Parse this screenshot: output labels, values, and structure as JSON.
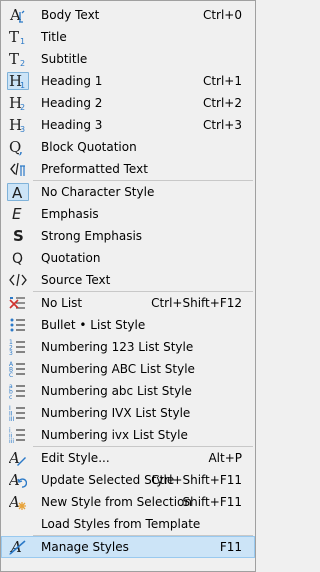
{
  "menu": {
    "items": [
      {
        "label": "Body Text",
        "shortcut": "Ctrl+0",
        "icon": "body-text-icon"
      },
      {
        "label": "Title",
        "shortcut": "",
        "icon": "title-icon"
      },
      {
        "label": "Subtitle",
        "shortcut": "",
        "icon": "subtitle-icon"
      },
      {
        "label": "Heading 1",
        "shortcut": "Ctrl+1",
        "icon": "heading-1-icon",
        "checked": true
      },
      {
        "label": "Heading 2",
        "shortcut": "Ctrl+2",
        "icon": "heading-2-icon"
      },
      {
        "label": "Heading 3",
        "shortcut": "Ctrl+3",
        "icon": "heading-3-icon"
      },
      {
        "label": "Block Quotation",
        "shortcut": "",
        "icon": "block-quotation-icon"
      },
      {
        "label": "Preformatted Text",
        "shortcut": "",
        "icon": "preformatted-text-icon"
      },
      {
        "label": "No Character Style",
        "shortcut": "",
        "icon": "no-character-style-icon",
        "checked": true
      },
      {
        "label": "Emphasis",
        "shortcut": "",
        "icon": "emphasis-icon"
      },
      {
        "label": "Strong Emphasis",
        "shortcut": "",
        "icon": "strong-emphasis-icon"
      },
      {
        "label": "Quotation",
        "shortcut": "",
        "icon": "quotation-icon"
      },
      {
        "label": "Source Text",
        "shortcut": "",
        "icon": "source-text-icon"
      },
      {
        "label": "No List",
        "shortcut": "Ctrl+Shift+F12",
        "icon": "no-list-icon"
      },
      {
        "label": "Bullet • List Style",
        "shortcut": "",
        "icon": "bullet-list-icon"
      },
      {
        "label": "Numbering 123 List Style",
        "shortcut": "",
        "icon": "numbering-123-icon"
      },
      {
        "label": "Numbering ABC List Style",
        "shortcut": "",
        "icon": "numbering-abc-upper-icon"
      },
      {
        "label": "Numbering abc List Style",
        "shortcut": "",
        "icon": "numbering-abc-lower-icon"
      },
      {
        "label": "Numbering IVX List Style",
        "shortcut": "",
        "icon": "numbering-ivx-upper-icon"
      },
      {
        "label": "Numbering ivx List Style",
        "shortcut": "",
        "icon": "numbering-ivx-lower-icon"
      },
      {
        "label": "Edit Style...",
        "shortcut": "Alt+P",
        "icon": "edit-style-icon"
      },
      {
        "label": "Update Selected Style",
        "shortcut": "Ctrl+Shift+F11",
        "icon": "update-style-icon"
      },
      {
        "label": "New Style from Selection",
        "shortcut": "Shift+F11",
        "icon": "new-style-icon"
      },
      {
        "label": "Load Styles from Template",
        "shortcut": "",
        "icon": ""
      },
      {
        "label": "Manage Styles",
        "shortcut": "F11",
        "icon": "manage-styles-icon",
        "selected": true
      }
    ]
  },
  "colors": {
    "menu_bg": "#f0f0f0",
    "highlight": "#cce4f7",
    "icon_blue": "#2b79c7",
    "icon_red": "#d0312d",
    "icon_orange": "#e8a33a"
  }
}
